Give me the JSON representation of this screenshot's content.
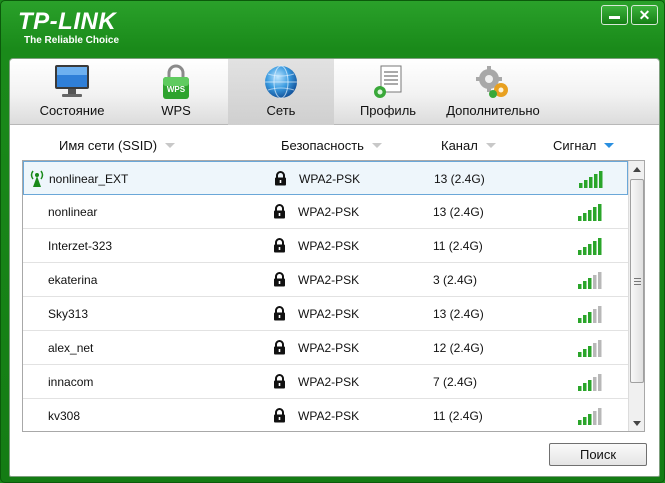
{
  "app": {
    "logo": "TP-LINK",
    "tagline": "The Reliable Choice"
  },
  "tabs": [
    {
      "label": "Состояние",
      "icon": "monitor-icon"
    },
    {
      "label": "WPS",
      "icon": "wps-lock-icon"
    },
    {
      "label": "Сеть",
      "icon": "globe-icon",
      "active": true
    },
    {
      "label": "Профиль",
      "icon": "profile-document-icon"
    },
    {
      "label": "Дополнительно",
      "icon": "gears-icon"
    }
  ],
  "columns": {
    "ssid": "Имя сети (SSID)",
    "security": "Безопасность",
    "channel": "Канал",
    "signal": "Сигнал"
  },
  "networks": [
    {
      "ssid": "nonlinear_EXT",
      "security": "WPA2-PSK",
      "channel": "13 (2.4G)",
      "signal_bars": 5,
      "connected": true
    },
    {
      "ssid": "nonlinear",
      "security": "WPA2-PSK",
      "channel": "13 (2.4G)",
      "signal_bars": 5
    },
    {
      "ssid": "Interzet-323",
      "security": "WPA2-PSK",
      "channel": "11 (2.4G)",
      "signal_bars": 5
    },
    {
      "ssid": "ekaterina",
      "security": "WPA2-PSK",
      "channel": "3 (2.4G)",
      "signal_bars": 3
    },
    {
      "ssid": "Sky313",
      "security": "WPA2-PSK",
      "channel": "13 (2.4G)",
      "signal_bars": 3
    },
    {
      "ssid": "alex_net",
      "security": "WPA2-PSK",
      "channel": "12 (2.4G)",
      "signal_bars": 3
    },
    {
      "ssid": "innacom",
      "security": "WPA2-PSK",
      "channel": "7 (2.4G)",
      "signal_bars": 3
    },
    {
      "ssid": "kv308",
      "security": "WPA2-PSK",
      "channel": "11 (2.4G)",
      "signal_bars": 3
    }
  ],
  "buttons": {
    "search": "Поиск"
  },
  "colors": {
    "brand_green": "#1a8a1a",
    "signal_green": "#2aa52a",
    "signal_gray": "#b8b8b8",
    "selection_border": "#6aa7d8",
    "sort_arrow_active": "#2a8fe0"
  }
}
